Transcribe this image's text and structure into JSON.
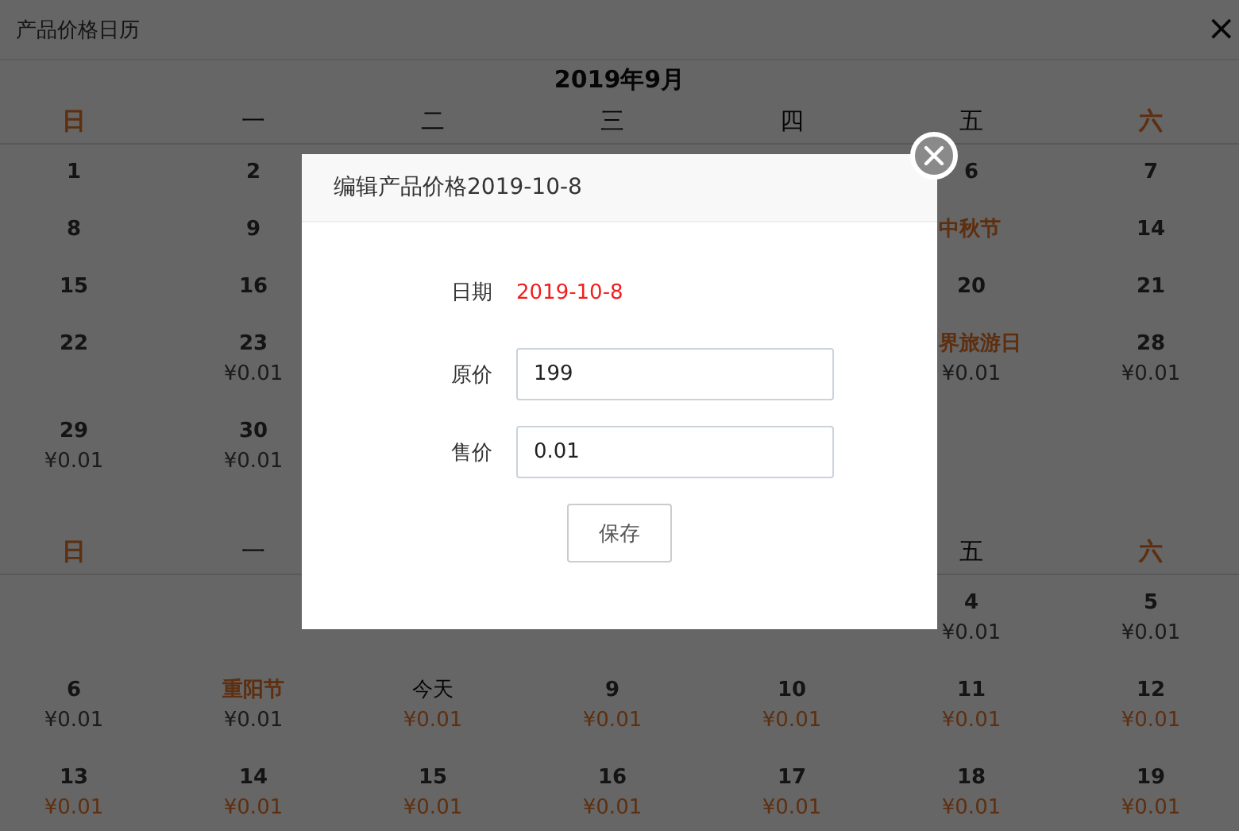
{
  "window": {
    "title": "产品价格日历",
    "close": "×"
  },
  "months": [
    {
      "title": "2019年9月",
      "weekdays": {
        "sun": {
          "label": "日",
          "kind": "weekend"
        },
        "mon": {
          "label": "一",
          "kind": "weekday"
        },
        "tue": {
          "label": "二",
          "kind": "weekday"
        },
        "wed": {
          "label": "三",
          "kind": "weekday"
        },
        "thu": {
          "label": "四",
          "kind": "weekday"
        },
        "fri": {
          "label": "五",
          "kind": "weekday"
        },
        "sat": {
          "label": "六",
          "kind": "weekend"
        }
      },
      "weeks": [
        {
          "sun": {
            "label": "1",
            "kind": "date"
          },
          "mon": {
            "label": "2",
            "kind": "date"
          },
          "fri": {
            "label": "6",
            "kind": "date"
          },
          "sat": {
            "label": "7",
            "kind": "date"
          }
        },
        {
          "sun": {
            "label": "8",
            "kind": "date"
          },
          "mon": {
            "label": "9",
            "kind": "date"
          },
          "fri": {
            "label": "中秋节",
            "kind": "holiday"
          },
          "sat": {
            "label": "14",
            "kind": "date"
          }
        },
        {
          "sun": {
            "label": "15",
            "kind": "date"
          },
          "mon": {
            "label": "16",
            "kind": "date"
          },
          "fri": {
            "label": "20",
            "kind": "date"
          },
          "sat": {
            "label": "21",
            "kind": "date"
          }
        },
        {
          "sun": {
            "label": "22",
            "kind": "date"
          },
          "mon": {
            "label": "23",
            "kind": "date",
            "price": "¥0.01",
            "bookable": false
          },
          "fri": {
            "label": "界旅游日",
            "kind": "holiday",
            "price": "¥0.01",
            "bookable": false
          },
          "sat": {
            "label": "28",
            "kind": "date",
            "price": "¥0.01",
            "bookable": false
          }
        },
        {
          "sun": {
            "label": "29",
            "kind": "date",
            "price": "¥0.01",
            "bookable": false
          },
          "mon": {
            "label": "30",
            "kind": "date",
            "price": "¥0.01",
            "bookable": false
          }
        }
      ]
    },
    {
      "weekdays": {
        "sun": {
          "label": "日",
          "kind": "weekend"
        },
        "mon": {
          "label": "一",
          "kind": "weekday"
        },
        "fri": {
          "label": "五",
          "kind": "weekday"
        },
        "sat": {
          "label": "六",
          "kind": "weekend"
        }
      },
      "weeks": [
        {
          "fri": {
            "label": "4",
            "kind": "date",
            "price": "¥0.01",
            "bookable": false
          },
          "sat": {
            "label": "5",
            "kind": "date",
            "price": "¥0.01",
            "bookable": false
          }
        },
        {
          "sun": {
            "label": "6",
            "kind": "date",
            "price": "¥0.01",
            "bookable": false
          },
          "mon": {
            "label": "重阳节",
            "kind": "holiday",
            "price": "¥0.01",
            "bookable": false
          },
          "tue": {
            "label": "今天",
            "kind": "today",
            "price": "¥0.01",
            "bookable": true
          },
          "wed": {
            "label": "9",
            "kind": "date",
            "price": "¥0.01",
            "bookable": true
          },
          "thu": {
            "label": "10",
            "kind": "date",
            "price": "¥0.01",
            "bookable": true
          },
          "fri": {
            "label": "11",
            "kind": "date",
            "price": "¥0.01",
            "bookable": true
          },
          "sat": {
            "label": "12",
            "kind": "date",
            "price": "¥0.01",
            "bookable": true
          }
        },
        {
          "sun": {
            "label": "13",
            "kind": "date",
            "price": "¥0.01",
            "bookable": true
          },
          "mon": {
            "label": "14",
            "kind": "date",
            "price": "¥0.01",
            "bookable": true
          },
          "tue": {
            "label": "15",
            "kind": "date",
            "price": "¥0.01",
            "bookable": true
          },
          "wed": {
            "label": "16",
            "kind": "date",
            "price": "¥0.01",
            "bookable": true
          },
          "thu": {
            "label": "17",
            "kind": "date",
            "price": "¥0.01",
            "bookable": true
          },
          "fri": {
            "label": "18",
            "kind": "date",
            "price": "¥0.01",
            "bookable": true
          },
          "sat": {
            "label": "19",
            "kind": "date",
            "price": "¥0.01",
            "bookable": true
          }
        }
      ]
    }
  ],
  "dialog": {
    "title": "编辑产品价格2019-10-8",
    "fields": [
      {
        "label": "日期",
        "kind": "text",
        "value": "2019-10-8"
      },
      {
        "label": "原价",
        "kind": "input",
        "value": "199"
      },
      {
        "label": "售价",
        "kind": "input",
        "value": "0.01"
      }
    ],
    "button": "保存"
  }
}
